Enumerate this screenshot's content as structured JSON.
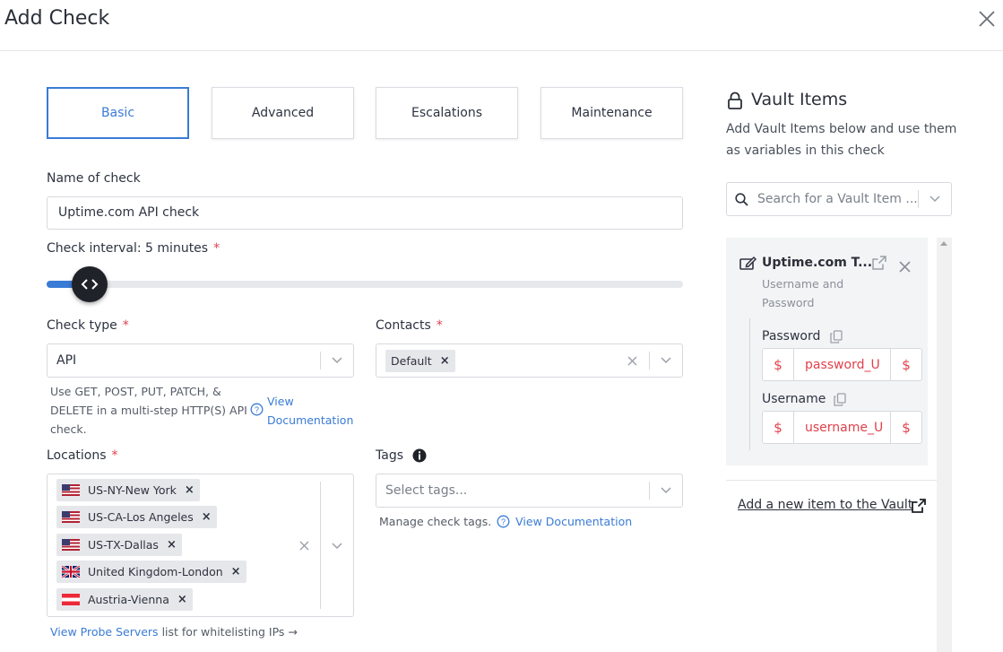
{
  "dialog": {
    "title": "Add Check"
  },
  "tabs": [
    "Basic",
    "Advanced",
    "Escalations",
    "Maintenance"
  ],
  "active_tab": "Basic",
  "name_field": {
    "label": "Name of check",
    "value": "Uptime.com API check"
  },
  "interval": {
    "label": "Check interval: 5 minutes",
    "required": "*",
    "level_fraction": 0.05
  },
  "check_type": {
    "label": "Check type",
    "required": "*",
    "value": "API",
    "help_text": "Use GET, POST, PUT, PATCH, & DELETE in a multi-step HTTP(S) API check.",
    "help_line1": "Use GET, POST, PUT, PATCH, &",
    "help_line2": "DELETE in a multi-step HTTP(S) API",
    "help_line3": "check.",
    "doc_link1": "View",
    "doc_link2": "Documentation"
  },
  "contacts": {
    "label": "Contacts",
    "required": "*",
    "chips": [
      "Default"
    ]
  },
  "locations": {
    "label": "Locations",
    "required": "*",
    "chips": [
      "US-NY-New York",
      "US-CA-Los Angeles",
      "US-TX-Dallas",
      "United Kingdom-London",
      "Austria-Vienna"
    ],
    "footer_link": "View Probe Servers",
    "footer_text": "list for whitelisting IPs →"
  },
  "tags": {
    "label": "Tags",
    "placeholder": "Select tags...",
    "help": "Manage check tags.",
    "doc_link": "View Documentation"
  },
  "vault": {
    "title": "Vault Items",
    "description": "Add Vault Items below and use them as variables in this check",
    "search_placeholder": "Search for a Vault Item ...",
    "item": {
      "name": "Uptime.com T...",
      "type_line1": "Username and",
      "type_line2": "Password",
      "fields": [
        {
          "label": "Password",
          "prefix": "$",
          "value": "password_U",
          "suffix": "$"
        },
        {
          "label": "Username",
          "prefix": "$",
          "value": "username_U",
          "suffix": "$"
        }
      ]
    },
    "add_link": "Add a new item to the Vault"
  },
  "colors": {
    "accent": "#3a7bd5",
    "required": "#e0414b",
    "knob": "#1f2329"
  }
}
